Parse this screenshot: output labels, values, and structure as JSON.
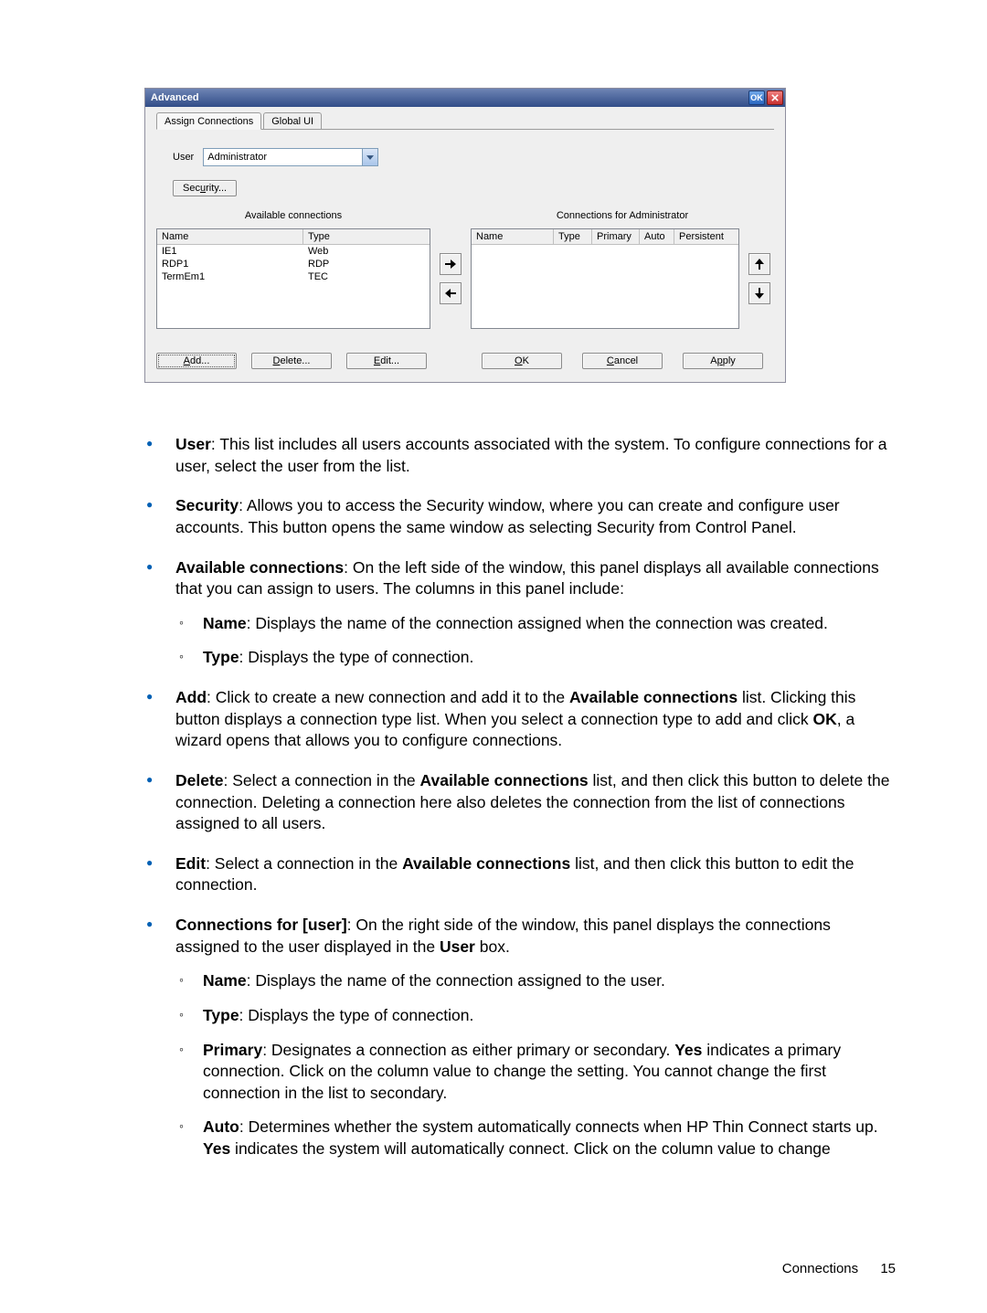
{
  "dialog": {
    "title": "Advanced",
    "ok_badge": "OK",
    "tabs": {
      "active": "Assign Connections",
      "inactive": "Global UI"
    },
    "user_label": "User",
    "user_value": "Administrator",
    "security_btn_parts": {
      "pre": "Sec",
      "ul": "u",
      "post": "rity..."
    },
    "left_panel_title": "Available connections",
    "right_panel_title": "Connections for Administrator",
    "left_headers": {
      "name": "Name",
      "type": "Type"
    },
    "right_headers": {
      "name": "Name",
      "type": "Type",
      "primary": "Primary",
      "auto": "Auto",
      "persistent": "Persistent"
    },
    "left_rows": [
      {
        "name": "IE1",
        "type": "Web"
      },
      {
        "name": "RDP1",
        "type": "RDP"
      },
      {
        "name": "TermEm1",
        "type": "TEC"
      }
    ],
    "buttons": {
      "add": {
        "ul": "A",
        "post": "dd..."
      },
      "delete": {
        "ul": "D",
        "post": "elete..."
      },
      "edit": {
        "ul": "E",
        "post": "dit..."
      },
      "ok": {
        "ul": "O",
        "post": "K"
      },
      "cancel": {
        "ul": "C",
        "post": "ancel"
      },
      "apply": {
        "pre": "A",
        "ul": "p",
        "post": "ply"
      }
    }
  },
  "text": {
    "b1_lead": "User",
    "b1_body": ": This list includes all users accounts associated with the system. To configure connections for a user, select the user from the list.",
    "b2_lead": "Security",
    "b2_body": ": Allows you to access the Security window, where you can create and configure user accounts. This button opens the same window as selecting Security from Control Panel.",
    "b3_lead": "Available connections",
    "b3_body": ": On the left side of the window, this panel displays all available connections that you can assign to users. The columns in this panel include:",
    "b3_s1_lead": "Name",
    "b3_s1_body": ": Displays the name of the connection assigned when the connection was created.",
    "b3_s2_lead": "Type",
    "b3_s2_body": ": Displays the type of connection.",
    "b4_lead": "Add",
    "b4_body_pre": ": Click to create a new connection and add it to the ",
    "b4_bold1": "Available connections",
    "b4_body_mid": " list. Clicking this button displays a connection type list. When you select a connection type to add and click ",
    "b4_bold2": "OK",
    "b4_body_post": ", a wizard opens that allows you to configure connections.",
    "b5_lead": "Delete",
    "b5_body_pre": ": Select a connection in the ",
    "b5_bold1": "Available connections",
    "b5_body_post": " list, and then click this button to delete the connection. Deleting a connection here also deletes the connection from the list of connections assigned to all users.",
    "b6_lead": "Edit",
    "b6_body_pre": ": Select a connection in the ",
    "b6_bold1": "Available connections",
    "b6_body_post": " list, and then click this button to edit the connection.",
    "b7_lead": "Connections for [user]",
    "b7_body_pre": ": On the right side of the window, this panel displays the connections assigned to the user displayed in the ",
    "b7_bold1": "User",
    "b7_body_post": " box.",
    "b7_s1_lead": "Name",
    "b7_s1_body": ": Displays the name of the connection assigned to the user.",
    "b7_s2_lead": "Type",
    "b7_s2_body": ": Displays the type of connection.",
    "b7_s3_lead": "Primary",
    "b7_s3_body_pre": ": Designates a connection as either primary or secondary. ",
    "b7_s3_bold1": "Yes",
    "b7_s3_body_post": " indicates a primary connection. Click on the column value to change the setting. You cannot change the first connection in the list to secondary.",
    "b7_s4_lead": "Auto",
    "b7_s4_body_pre": ": Determines whether the system automatically connects when HP Thin Connect starts up. ",
    "b7_s4_bold1": "Yes",
    "b7_s4_body_post": " indicates the system will automatically connect. Click on the column value to change"
  },
  "footer": {
    "section": "Connections",
    "page": "15"
  }
}
